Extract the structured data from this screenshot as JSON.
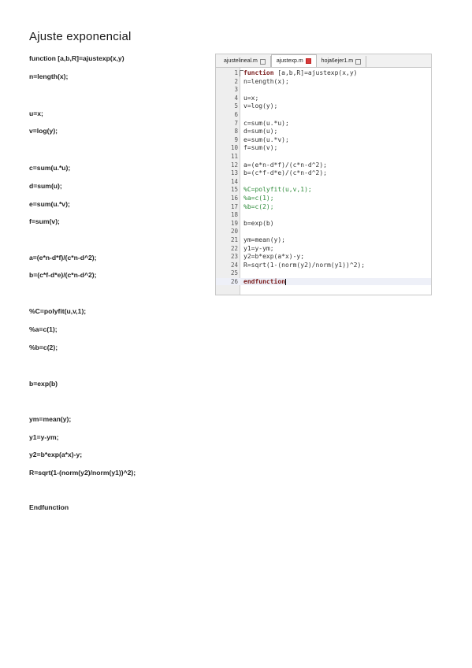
{
  "document": {
    "title": "Ajuste exponencial",
    "lines": [
      "function [a,b,R]=ajustexp(x,y)",
      "n=length(x);",
      "u=x;",
      "v=log(y);",
      "c=sum(u.*u);",
      "d=sum(u);",
      "e=sum(u.*v);",
      "f=sum(v);",
      "a=(e*n-d*f)/(c*n-d^2);",
      "b=(c*f-d*e)/(c*n-d^2);",
      "%C=polyfit(u,v,1);",
      "%a=c(1);",
      "%b=c(2);",
      "b=exp(b)",
      "ym=mean(y);",
      "y1=y-ym;",
      "y2=b*exp(a*x)-y;",
      "R=sqrt(1-(norm(y2)/norm(y1))^2);",
      "Endfunction"
    ]
  },
  "editor": {
    "tabs": [
      {
        "label": "ajustelineal.m",
        "active": false
      },
      {
        "label": "ajustexp.m",
        "active": true
      },
      {
        "label": "hoja6ejer1.m",
        "active": false
      }
    ],
    "code_lines": [
      {
        "num": "1",
        "text": "function [a,b,R]=ajustexp(x,y)",
        "kind": "kw"
      },
      {
        "num": "2",
        "text": "n=length(x);",
        "kind": "plain"
      },
      {
        "num": "3",
        "text": "",
        "kind": "plain"
      },
      {
        "num": "4",
        "text": "u=x;",
        "kind": "plain"
      },
      {
        "num": "5",
        "text": "v=log(y);",
        "kind": "plain"
      },
      {
        "num": "6",
        "text": "",
        "kind": "plain"
      },
      {
        "num": "7",
        "text": "c=sum(u.*u);",
        "kind": "plain"
      },
      {
        "num": "8",
        "text": "d=sum(u);",
        "kind": "plain"
      },
      {
        "num": "9",
        "text": "e=sum(u.*v);",
        "kind": "plain"
      },
      {
        "num": "10",
        "text": "f=sum(v);",
        "kind": "plain"
      },
      {
        "num": "11",
        "text": "",
        "kind": "plain"
      },
      {
        "num": "12",
        "text": "a=(e*n-d*f)/(c*n-d^2);",
        "kind": "plain"
      },
      {
        "num": "13",
        "text": "b=(c*f-d*e)/(c*n-d^2);",
        "kind": "plain"
      },
      {
        "num": "14",
        "text": "",
        "kind": "plain"
      },
      {
        "num": "15",
        "text": "%C=polyfit(u,v,1);",
        "kind": "cm"
      },
      {
        "num": "16",
        "text": "%a=c(1);",
        "kind": "cm"
      },
      {
        "num": "17",
        "text": "%b=c(2);",
        "kind": "cm"
      },
      {
        "num": "18",
        "text": "",
        "kind": "plain"
      },
      {
        "num": "19",
        "text": "b=exp(b)",
        "kind": "plain"
      },
      {
        "num": "20",
        "text": "",
        "kind": "plain"
      },
      {
        "num": "21",
        "text": "ym=mean(y);",
        "kind": "plain"
      },
      {
        "num": "22",
        "text": "y1=y-ym;",
        "kind": "plain"
      },
      {
        "num": "23",
        "text": "y2=b*exp(a*x)-y;",
        "kind": "plain"
      },
      {
        "num": "24",
        "text": "R=sqrt(1-(norm(y2)/norm(y1))^2);",
        "kind": "plain"
      },
      {
        "num": "25",
        "text": "",
        "kind": "plain"
      },
      {
        "num": "26",
        "text": "endfunction",
        "kind": "kw"
      }
    ],
    "colors": {
      "keyword": "#7a1c1c",
      "comment": "#2e8b3a",
      "close_active": "#d73c3c"
    }
  }
}
